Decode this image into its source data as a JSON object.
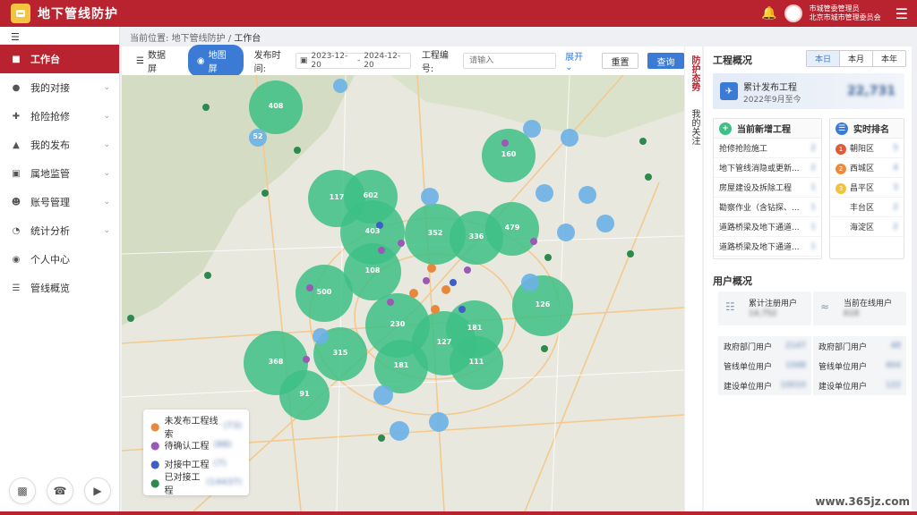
{
  "header": {
    "app_title": "地下管线防护",
    "user_role": "市城管委管理员",
    "user_org": "北京市城市管理委员会"
  },
  "sidebar": {
    "items": [
      {
        "label": "工作台",
        "icon": "workbench-icon",
        "active": true
      },
      {
        "label": "我的对接",
        "icon": "docking-icon"
      },
      {
        "label": "抢险抢修",
        "icon": "repair-icon"
      },
      {
        "label": "我的发布",
        "icon": "publish-icon"
      },
      {
        "label": "属地监管",
        "icon": "supervision-icon"
      },
      {
        "label": "账号管理",
        "icon": "account-icon"
      },
      {
        "label": "统计分析",
        "icon": "statistics-icon"
      },
      {
        "label": "个人中心",
        "icon": "personal-icon"
      },
      {
        "label": "管线概览",
        "icon": "pipeline-icon"
      }
    ]
  },
  "breadcrumb": {
    "prefix": "当前位置:",
    "path1": "地下管线防护",
    "sep": "/",
    "current": "工作台"
  },
  "toolbar": {
    "tab_data": "数据屏",
    "tab_map": "地图屏",
    "publish_time_label": "发布时间:",
    "date_start": "2023-12-20",
    "date_sep": "-",
    "date_end": "2024-12-20",
    "project_no_label": "工程编号:",
    "project_no_placeholder": "请输入",
    "expand": "展开",
    "reset": "重置",
    "query": "查询"
  },
  "vertical_tabs": {
    "protect": "防护态势",
    "focus": "我的关注"
  },
  "legend": [
    {
      "label": "未发布工程线索",
      "count": "(73)",
      "color": "#e8883a"
    },
    {
      "label": "待确认工程",
      "count": "(88)",
      "color": "#9b59b6"
    },
    {
      "label": "对接中工程",
      "count": "(7)",
      "color": "#3d5fc4"
    },
    {
      "label": "已对接工程",
      "count": "(14437)",
      "color": "#2d8a4e"
    }
  ],
  "clusters": [
    {
      "value": "408",
      "size": "big"
    },
    {
      "value": "52",
      "size": "small"
    },
    {
      "value": "160",
      "size": "big"
    },
    {
      "value": "117",
      "size": "big"
    },
    {
      "value": "602",
      "size": "big"
    },
    {
      "value": "403",
      "size": "big"
    },
    {
      "value": "352",
      "size": "big"
    },
    {
      "value": "336",
      "size": "big"
    },
    {
      "value": "479",
      "size": "big"
    },
    {
      "value": "108",
      "size": "big"
    },
    {
      "value": "500",
      "size": "big"
    },
    {
      "value": "230",
      "size": "big"
    },
    {
      "value": "127",
      "size": "big"
    },
    {
      "value": "181",
      "size": "big"
    },
    {
      "value": "126",
      "size": "big"
    },
    {
      "value": "368",
      "size": "big"
    },
    {
      "value": "315",
      "size": "big"
    },
    {
      "value": "181",
      "size": "big"
    },
    {
      "value": "111",
      "size": "big"
    },
    {
      "value": "91",
      "size": "mid"
    }
  ],
  "right": {
    "overview_title": "工程概况",
    "ranges": [
      "本日",
      "本月",
      "本年"
    ],
    "cum_title": "累计发布工程",
    "cum_sub": "2022年9月至今",
    "cum_value": "22,731",
    "new_title": "当前新增工程",
    "new_items": [
      "抢修抢险施工",
      "地下管线消隐或更新...",
      "房屋建设及拆除工程",
      "勘察作业（含钻探、...",
      "道路桥梁及地下通道...",
      "道路桥梁及地下通道..."
    ],
    "rank_title": "实时排名",
    "rank_items": [
      "朝阳区",
      "西城区",
      "昌平区",
      "丰台区",
      "海淀区"
    ],
    "user_title": "用户概况",
    "reg_label": "累计注册用户",
    "reg_value": "14,752",
    "online_label": "当前在线用户",
    "online_value": "618",
    "left_rows": [
      {
        "label": "政府部门用户",
        "value": "2147"
      },
      {
        "label": "管线单位用户",
        "value": "1048"
      },
      {
        "label": "建设单位用户",
        "value": "10010"
      }
    ],
    "right_rows": [
      {
        "label": "政府部门用户",
        "value": "48"
      },
      {
        "label": "管线单位用户",
        "value": "404"
      },
      {
        "label": "建设单位用户",
        "value": "122"
      }
    ]
  },
  "watermark": "www.365jz.com"
}
